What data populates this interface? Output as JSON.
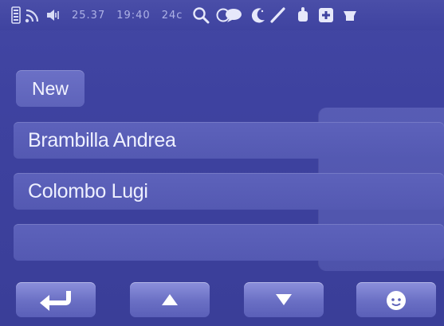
{
  "status_bar": {
    "counter": "25.37",
    "time": "19:40",
    "temperature": "24c",
    "icons": [
      "memory-icon",
      "signal-icon",
      "speaker-icon",
      "search-icon",
      "speech-bubble-icon",
      "moon-icon",
      "pen-icon",
      "hand-icon",
      "plus-icon",
      "tray-icon"
    ]
  },
  "list": {
    "new_label": "New",
    "items": [
      {
        "label": "Brambilla Andrea"
      },
      {
        "label": "Colombo Lugi"
      },
      {
        "label": ""
      }
    ]
  },
  "bottom_bar": {
    "buttons": [
      "enter-icon",
      "arrow-up-icon",
      "arrow-down-icon",
      "face-icon"
    ]
  },
  "colors": {
    "background": "#3e42a0",
    "row": "#575cb5",
    "button": "#7a7fd0",
    "text": "#eef0ff"
  }
}
